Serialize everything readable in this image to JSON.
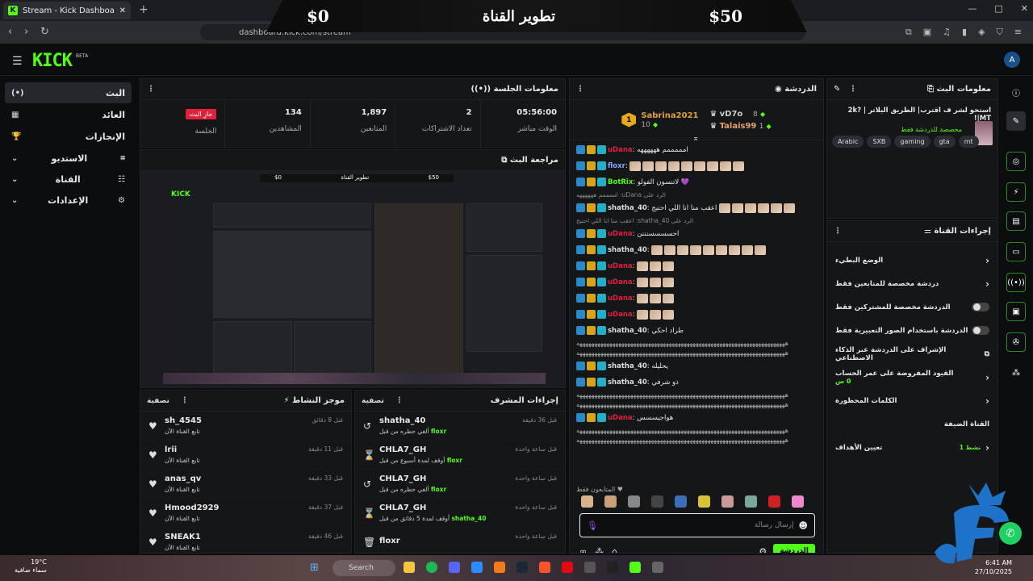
{
  "browser": {
    "tab_title": "Stream - Kick Dashboard",
    "url": "dashboard.kick.com/stream",
    "new_tab": "+",
    "win_min": "—",
    "win_max": "□",
    "win_close": "✕"
  },
  "banner": {
    "left": "$0",
    "center": "تطوير القناة",
    "right": "$50"
  },
  "header": {
    "logo": "KICK",
    "beta": "BETA"
  },
  "sidebar": {
    "items": [
      {
        "label": "البث",
        "icon": "(•)"
      },
      {
        "label": "العائد",
        "icon": "▦"
      },
      {
        "label": "الإنجازات",
        "icon": "🏆"
      },
      {
        "label": "الاستديو",
        "icon": "⌄"
      },
      {
        "label": "القناة",
        "icon": "⌄"
      },
      {
        "label": "الإعدادات",
        "icon": "⌄"
      }
    ]
  },
  "session": {
    "title": "معلومات الجلسة",
    "live_badge": "جارِ البث",
    "stats": [
      {
        "value": "",
        "label": "الجلسة"
      },
      {
        "value": "134",
        "label": "المشاهدين"
      },
      {
        "value": "1,897",
        "label": "المتابعين"
      },
      {
        "value": "2",
        "label": "تعداد الاشتراكات"
      },
      {
        "value": "05:56:00",
        "label": "الوقت مباشر"
      }
    ]
  },
  "preview": {
    "title": "مراجعة البث",
    "mini_left": "$0",
    "mini_center": "تطوير القناة",
    "mini_right": "$50",
    "mini_logo": "KICK"
  },
  "activity": {
    "title": "موجز النشاط",
    "filter": "تصفية",
    "rows": [
      {
        "name": "sh_4545",
        "sub": "تابع القناة الآن",
        "time": "قبل 8 دقائق"
      },
      {
        "name": "lrii",
        "sub": "تابع القناة الآن",
        "time": "قبل 11 دقيقة"
      },
      {
        "name": "anas_qv",
        "sub": "تابع القناة الآن",
        "time": "قبل 33 دقيقة"
      },
      {
        "name": "Hmood2929",
        "sub": "تابع القناة الآن",
        "time": "قبل 37 دقيقة"
      },
      {
        "name": "SNEAK1",
        "sub": "تابع القناة الآن",
        "time": "قبل 46 دقيقة"
      }
    ]
  },
  "modactions": {
    "title": "إجراءات المشرف",
    "filter": "تصفية",
    "rows": [
      {
        "name": "shatha_40",
        "sub": "ألغي حظره من قبل",
        "by": "floxr",
        "time": "قبل 36 دقيقة",
        "icon": "↺"
      },
      {
        "name": "CHLA7_GH",
        "sub": "أوقف لمدة أسبوع من قبل",
        "by": "floxr",
        "time": "قبل ساعة واحدة",
        "icon": "⌛"
      },
      {
        "name": "CHLA7_GH",
        "sub": "ألغي حظره من قبل",
        "by": "floxr",
        "time": "قبل ساعة واحدة",
        "icon": "↺"
      },
      {
        "name": "CHLA7_GH",
        "sub": "أوقف لمدة 5 دقائق من قبل",
        "by": "shatha_40",
        "time": "قبل ساعة واحدة",
        "icon": "⌛"
      },
      {
        "name": "floxr",
        "sub": "",
        "by": "",
        "time": "قبل ساعة واحدة",
        "icon": "🗑"
      }
    ]
  },
  "chat": {
    "title": "الدردشة",
    "leaders": [
      {
        "rank": "1",
        "name": "Sabrina2021",
        "score": "10"
      },
      {
        "name": "vD7o",
        "score": "8"
      },
      {
        "name": "Talais99",
        "score": "1"
      }
    ],
    "messages": [
      {
        "user": "uDana",
        "cls": "u-red",
        "text": "امممممم ههههههه",
        "emotes": 0
      },
      {
        "user": "floxr",
        "cls": "u-blue",
        "text": "",
        "emotes": 9
      },
      {
        "user": "BotRix",
        "cls": "u-green",
        "text": "لاتنسون الفولو 💜",
        "emotes": 0
      },
      {
        "user": "shatha_40",
        "cls": "u-white",
        "text": "اعقب منا انا اللي احتيج",
        "emotes": 6
      },
      {
        "user": "uDana",
        "cls": "u-red",
        "text": "احسسسسنننن",
        "emotes": 0
      },
      {
        "user": "shatha_40",
        "cls": "u-white",
        "text": "",
        "emotes": 9
      },
      {
        "user": "uDana",
        "cls": "u-red",
        "text": "",
        "emotes": 3
      },
      {
        "user": "uDana",
        "cls": "u-red",
        "text": "",
        "emotes": 3
      },
      {
        "user": "uDana",
        "cls": "u-red",
        "text": "",
        "emotes": 3
      },
      {
        "user": "uDana",
        "cls": "u-red",
        "text": "",
        "emotes": 3
      },
      {
        "user": "shatha_40",
        "cls": "u-white",
        "text": "طراد احكي",
        "emotes": 0
      },
      {
        "user": "shatha_40",
        "cls": "u-white",
        "text": "يحليله",
        "emotes": 0
      },
      {
        "user": "shatha_40",
        "cls": "u-white",
        "text": "ذو شرفي",
        "emotes": 0
      },
      {
        "user": "uDana",
        "cls": "u-red",
        "text": "هواجيسسس",
        "emotes": 0
      }
    ],
    "reply_1": "الرد على uDana: اممممم ههههههه",
    "reply_2": "الرد على shatha_40: اعقب منا انا اللي احتيج",
    "spam": "ههههههههههههههههههههههههههههههههههههههههههههههههههههههههههههههههههههههه",
    "followers_only": "المتابعون فقط",
    "input_placeholder": "إرسال رسالة",
    "send": "الدردشة"
  },
  "streaminfo": {
    "title": "معلومات البث",
    "stream_title": "استحو لشر ف اقترب| الطريق البلاتر | 2k? |MT!",
    "subtitle": "مخصصة للدردشة فقط",
    "tags": [
      "Arabic",
      "SXB",
      "gaming",
      "gta",
      "mt"
    ]
  },
  "channel_actions": {
    "title": "إجراءات القناة",
    "rows": [
      {
        "label": "الوضع البطيء",
        "control": "chevron"
      },
      {
        "label": "دردشة مخصصة للمتابعين فقط",
        "control": "chevron"
      },
      {
        "label": "الدردشة مخصصة للمشتركين فقط",
        "control": "toggle"
      },
      {
        "label": "الدردشة باستخدام الصور التعبيرية فقط",
        "control": "toggle"
      },
      {
        "label": "الإشراف على الدردشة عبر الذكاء الاصطناعي",
        "control": "external"
      },
      {
        "label": "القيود المفروضة على عمر الحساب",
        "control": "chevron",
        "sub": "0 س"
      },
      {
        "label": "الكلمات المحظورة",
        "control": "chevron"
      }
    ],
    "guest_section": "القناة الضيفة",
    "goals_label": "تعيين الأهداف",
    "goals_status": "نشط 1"
  },
  "taskbar": {
    "temp": "19°C",
    "weather": "سماء صافية",
    "search": "Search",
    "time": "6:41 AM",
    "date": "27/10/2025"
  },
  "colors": {
    "kick_green": "#53fc18",
    "live_red": "#e0213c"
  }
}
